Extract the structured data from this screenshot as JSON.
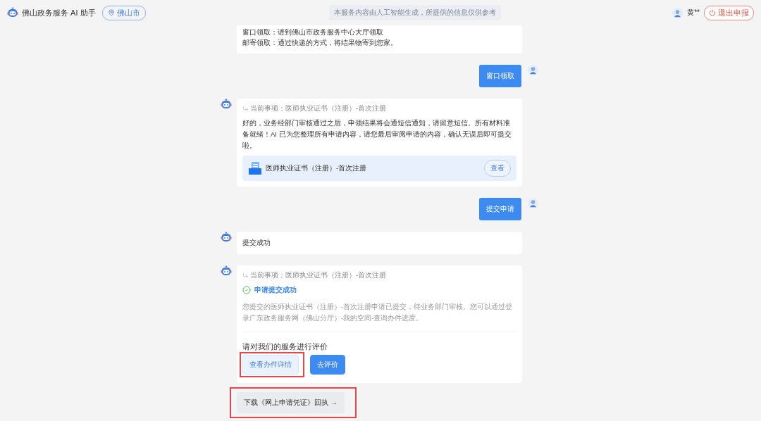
{
  "header": {
    "app_name": "佛山政务服务 AI 助手",
    "city": "佛山市",
    "notice": "本服务内容由人工智能生成，所提供的信息仅供参考",
    "user_name": "黄**",
    "exit_button": "退出申报"
  },
  "messages": [
    {
      "kind": "bot_partial",
      "lines": [
        "窗口领取：请到佛山市政务服务中心大厅领取",
        "邮寄领取：通过快递的方式，将结果物寄到您家。"
      ]
    },
    {
      "kind": "user",
      "text": "窗口领取"
    },
    {
      "kind": "bot_doc",
      "topic": "当前事项：医师执业证书（注册）-首次注册",
      "text": "好的，业务经部门审核通过之后，申领结果将会通短信通知，请留意短信。所有材料准备就绪！AI 已为您整理所有申请内容，请您最后审阅申请的内容，确认无误后即可提交啦。",
      "doc_title": "医师执业证书（注册）-首次注册",
      "doc_button": "查看"
    },
    {
      "kind": "user",
      "text": "提交申请"
    },
    {
      "kind": "bot_text",
      "text": "提交成功"
    },
    {
      "kind": "bot_result",
      "topic": "当前事项：医师执业证书（注册）-首次注册",
      "status": "申请提交成功",
      "text": "您提交的医师执业证书（注册）-首次注册申请已提交，待业务部门审核。您可以通过登录广东政务服务网（佛山分厅）-我的空间-查询办件进度。",
      "rating_prompt": "请对我们的服务进行评价",
      "buttons": [
        {
          "label": "查看办件详情",
          "primary": false,
          "highlighted": true
        },
        {
          "label": "去评价",
          "primary": true,
          "highlighted": false
        }
      ]
    },
    {
      "kind": "action",
      "label": "下载《网上申请凭证》回执 →",
      "highlighted": true
    }
  ]
}
